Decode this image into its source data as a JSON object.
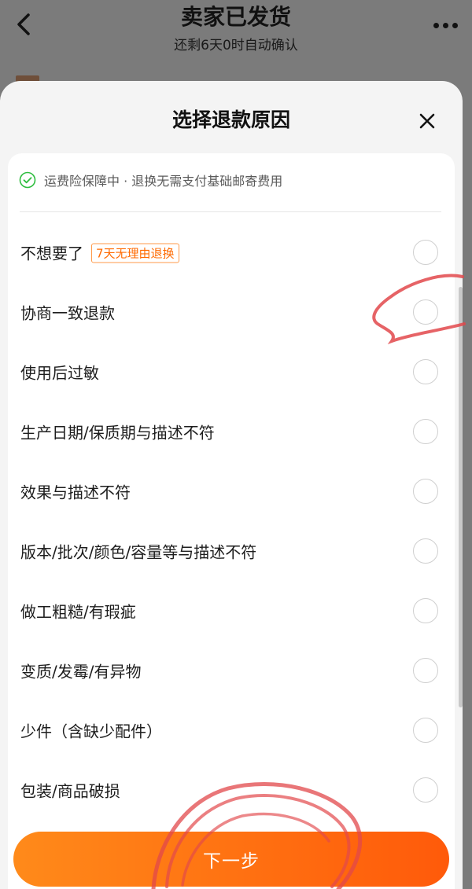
{
  "page": {
    "title": "卖家已发货",
    "subtitle": "还剩6天0时自动确认"
  },
  "sheet": {
    "title": "选择退款原因",
    "notice": "运费险保障中 · 退换无需支付基础邮寄费用",
    "reasons": [
      {
        "label": "不想要了",
        "tag": "7天无理由退换"
      },
      {
        "label": "协商一致退款"
      },
      {
        "label": "使用后过敏"
      },
      {
        "label": "生产日期/保质期与描述不符"
      },
      {
        "label": "效果与描述不符"
      },
      {
        "label": "版本/批次/颜色/容量等与描述不符"
      },
      {
        "label": "做工粗糙/有瑕疵"
      },
      {
        "label": "变质/发霉/有异物"
      },
      {
        "label": "少件（含缺少配件）"
      },
      {
        "label": "包装/商品破损"
      }
    ],
    "next_label": "下一步"
  },
  "colors": {
    "accent": "#ff6a00",
    "check_green": "#2ebd3f",
    "annotation_red": "#e2484b"
  }
}
